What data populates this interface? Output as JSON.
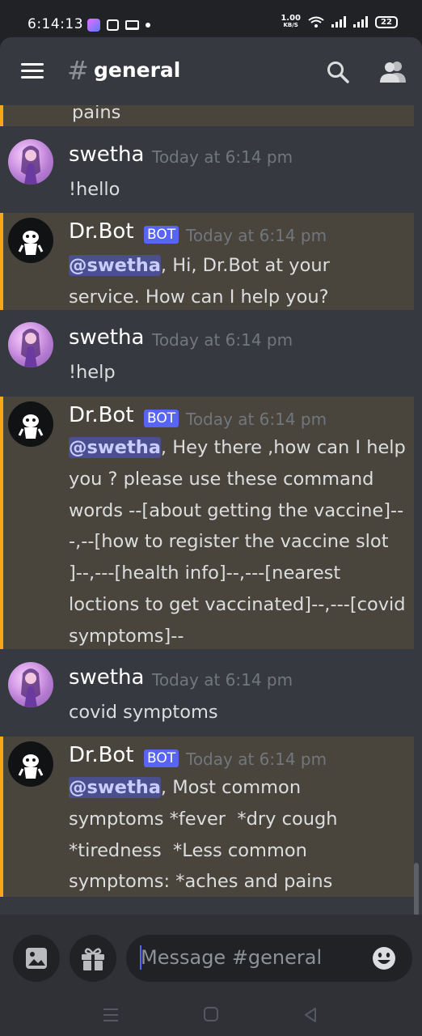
{
  "status_bar": {
    "time": "6:14:13",
    "net_speed_value": "1.00",
    "net_speed_unit": "KB/S",
    "battery": "22"
  },
  "header": {
    "channel_hash": "#",
    "channel_name": "general",
    "icons": [
      "menu-icon",
      "search-icon",
      "members-icon"
    ]
  },
  "messages": [
    {
      "type": "continuation",
      "body": "pains"
    },
    {
      "author": "swetha",
      "is_bot": false,
      "timestamp": "Today at 6:14 pm",
      "body": "!hello"
    },
    {
      "author": "Dr.Bot",
      "is_bot": true,
      "bot_tag": "BOT",
      "timestamp": "Today at 6:14 pm",
      "mention": "@swetha",
      "body": ", Hi, Dr.Bot at your service. How can I help you?"
    },
    {
      "author": "swetha",
      "is_bot": false,
      "timestamp": "Today at 6:14 pm",
      "body": "!help"
    },
    {
      "author": "Dr.Bot",
      "is_bot": true,
      "bot_tag": "BOT",
      "timestamp": "Today at 6:14 pm",
      "mention": "@swetha",
      "body": ", Hey there ,how can I help you ? please use these command words --[about getting the vaccine]---,--[how to register the vaccine slot ]--,---[health info]--,---[nearest loctions to get vaccinated]--,---[covid symptoms]--"
    },
    {
      "author": "swetha",
      "is_bot": false,
      "timestamp": "Today at 6:14 pm",
      "body": "covid symptoms"
    },
    {
      "author": "Dr.Bot",
      "is_bot": true,
      "bot_tag": "BOT",
      "timestamp": "Today at 6:14 pm",
      "mention": "@swetha",
      "body": ", Most common symptoms *fever  *dry cough  *tiredness  *Less common symptoms: *aches and pains"
    }
  ],
  "input": {
    "placeholder": "Message #general",
    "buttons": [
      "image-upload-icon",
      "gift-icon",
      "emoji-icon"
    ]
  },
  "colors": {
    "background": "#36393f",
    "highlight": "#49443c",
    "highlight_bar": "#faa61a",
    "bot_tag": "#5865f2",
    "mention_bg": "#4b4f8f"
  }
}
